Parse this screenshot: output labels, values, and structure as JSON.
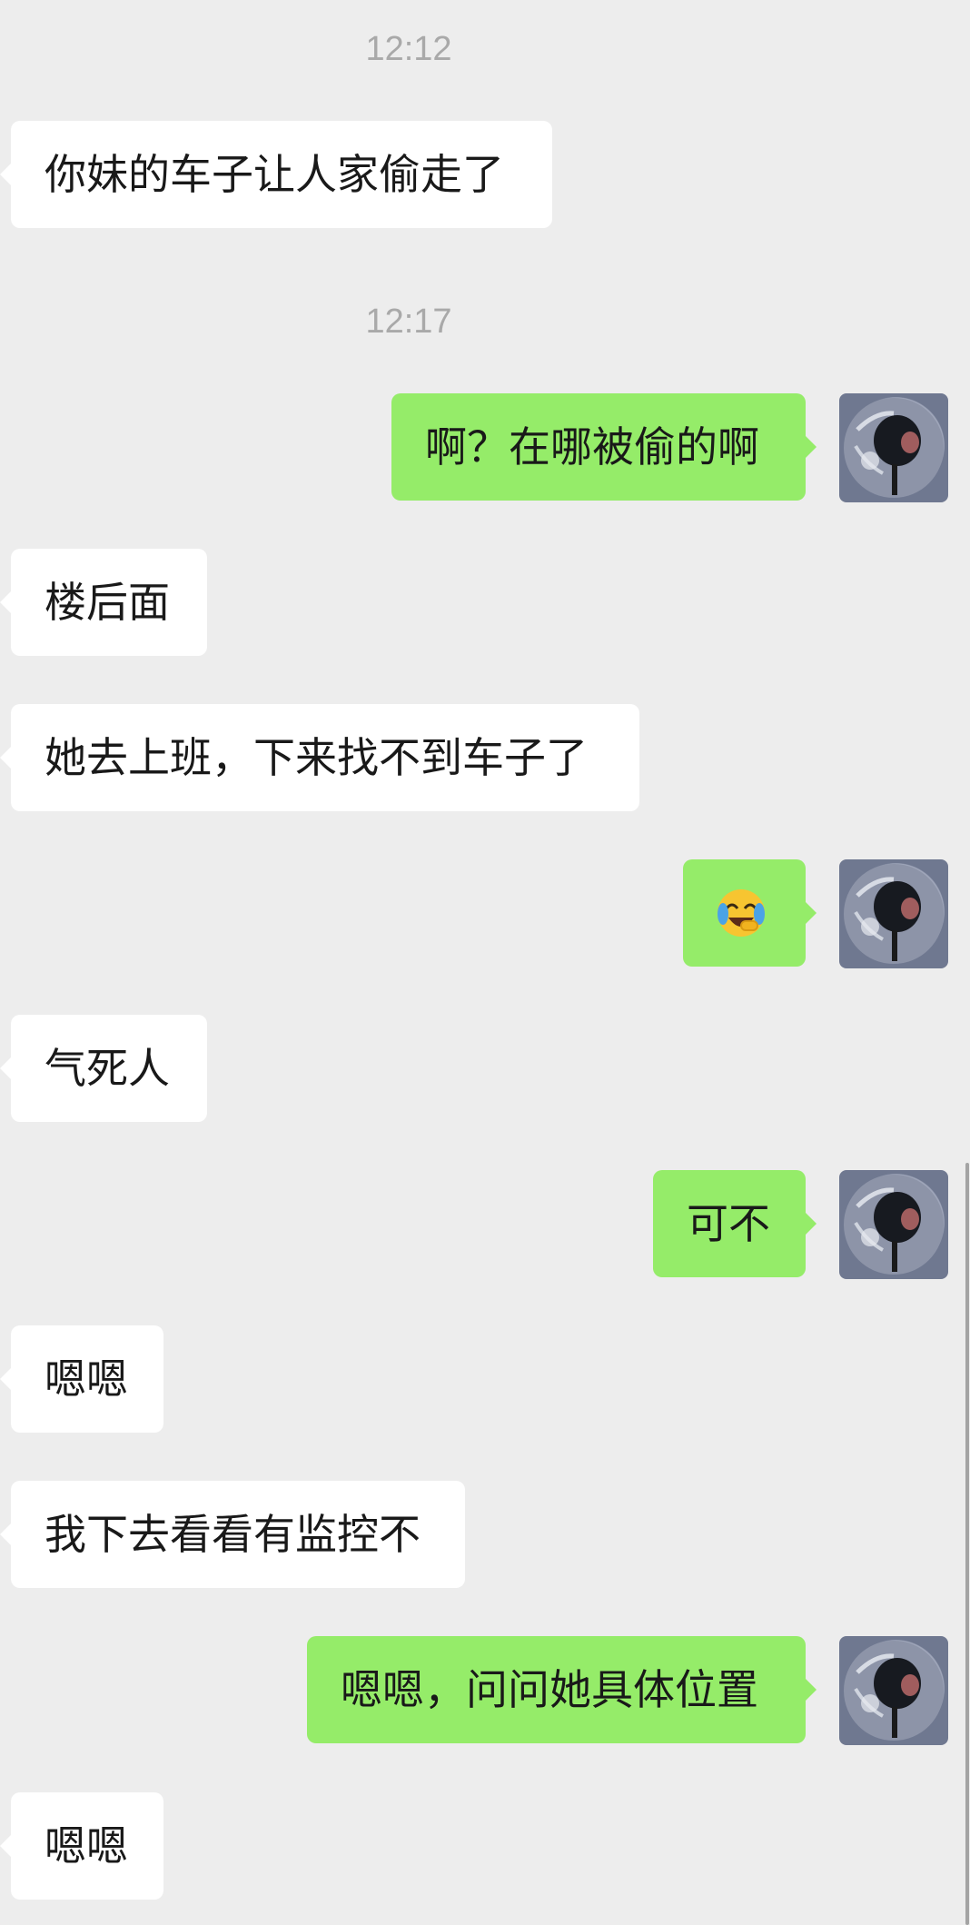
{
  "chat": {
    "timestamps": [
      "12:12",
      "12:17"
    ],
    "messages": [
      {
        "sender": "other",
        "text": "你妹的车子让人家偷走了"
      },
      {
        "sender": "self",
        "text": "啊？在哪被偷的啊"
      },
      {
        "sender": "other",
        "text": "楼后面"
      },
      {
        "sender": "other",
        "text": "她去上班，下来找不到车子了"
      },
      {
        "sender": "self",
        "text": "",
        "emoji": "face-with-tears-of-joy-icon"
      },
      {
        "sender": "other",
        "text": "气死人"
      },
      {
        "sender": "self",
        "text": "可不"
      },
      {
        "sender": "other",
        "text": "嗯嗯"
      },
      {
        "sender": "other",
        "text": "我下去看看有监控不"
      },
      {
        "sender": "self",
        "text": "嗯嗯，问问她具体位置"
      },
      {
        "sender": "other",
        "text": "嗯嗯"
      }
    ]
  },
  "colors": {
    "background": "#ededed",
    "incoming_bubble": "#ffffff",
    "outgoing_bubble": "#95ec69",
    "timestamp_text": "#a9a9a9"
  }
}
